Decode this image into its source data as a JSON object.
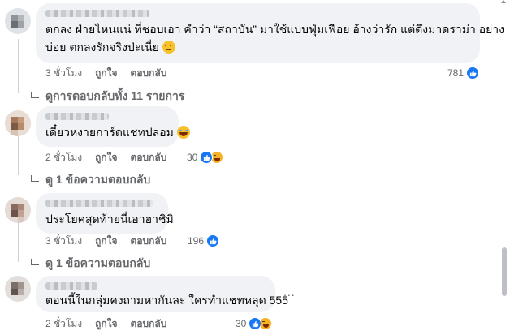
{
  "comments": [
    {
      "text_lines": [
        "ตกลง ฝ่ายไหนแน่ ที่ชอบเอา คำว่า “สถาบัน” มาใช้แบบฟุ่มเฟือย อ้างว่ารัก แต่ดึงมาดราม่า อย่าง",
        "บ่อย ตกลงรักจริงป่ะเนี่ย"
      ],
      "emoji": "thinking-face",
      "time": "3 ชั่วโมง",
      "like_label": "ถูกใจ",
      "reply_label": "ตอบกลับ",
      "reaction_count": "781",
      "view_replies": "ดูการตอบกลับทั้ง 11 รายการ"
    },
    {
      "text_lines": [
        "เดี๋ยวหงายการ์ดแชทปลอม"
      ],
      "emoji": "laughing-face",
      "time": "2 ชั่วโมง",
      "like_label": "ถูกใจ",
      "reply_label": "ตอบกลับ",
      "reaction_count": "30",
      "view_replies": "ดู 1 ข้อความตอบกลับ"
    },
    {
      "text_lines": [
        "ประโยคสุดท้ายนี่เอาฮาชิมิ"
      ],
      "time": "3 ชั่วโมง",
      "like_label": "ถูกใจ",
      "reply_label": "ตอบกลับ",
      "reaction_count": "196",
      "view_replies": "ดู 1 ข้อความตอบกลับ"
    },
    {
      "text_lines": [
        "ตอนนี้ในกลุ่มคงถามหากันละ ใครทำแชทหลุด 555"
      ],
      "time": "2 ชั่วโมง",
      "like_label": "ถูกใจ",
      "reply_label": "ตอบกลับ",
      "reaction_count": "30",
      "more": "..."
    }
  ],
  "colors": {
    "like_blue": "#1877f2",
    "bubble": "#f0f2f5",
    "meta": "#65676b",
    "text": "#050505"
  }
}
